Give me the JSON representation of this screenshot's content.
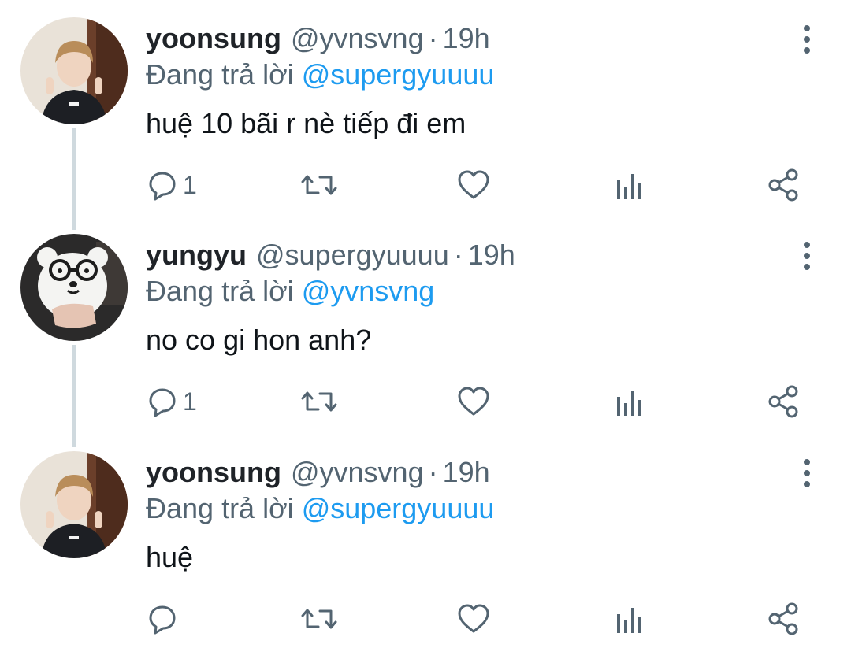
{
  "tweets": [
    {
      "display_name": "yoonsung",
      "handle": "@yvnsvng",
      "separator": "·",
      "time": "19h",
      "replying_label": "Đang trả lời",
      "replying_to": "@supergyuuuu",
      "text": "huệ 10 bãi r nè tiếp đi em",
      "reply_count": "1",
      "avatar_icon": "avatar-photo-person"
    },
    {
      "display_name": "yungyu",
      "handle": "@supergyuuuu",
      "separator": "·",
      "time": "19h",
      "replying_label": "Đang trả lời",
      "replying_to": "@yvnsvng",
      "text": "no co gi hon anh?",
      "reply_count": "1",
      "avatar_icon": "avatar-photo-bear-plush"
    },
    {
      "display_name": "yoonsung",
      "handle": "@yvnsvng",
      "separator": "·",
      "time": "19h",
      "replying_label": "Đang trả lời",
      "replying_to": "@supergyuuuu",
      "text": "huệ",
      "reply_count": "",
      "avatar_icon": "avatar-photo-person"
    }
  ],
  "colors": {
    "link": "#1d9bf0",
    "icon": "#536471",
    "thread_line": "#cfd9de"
  }
}
